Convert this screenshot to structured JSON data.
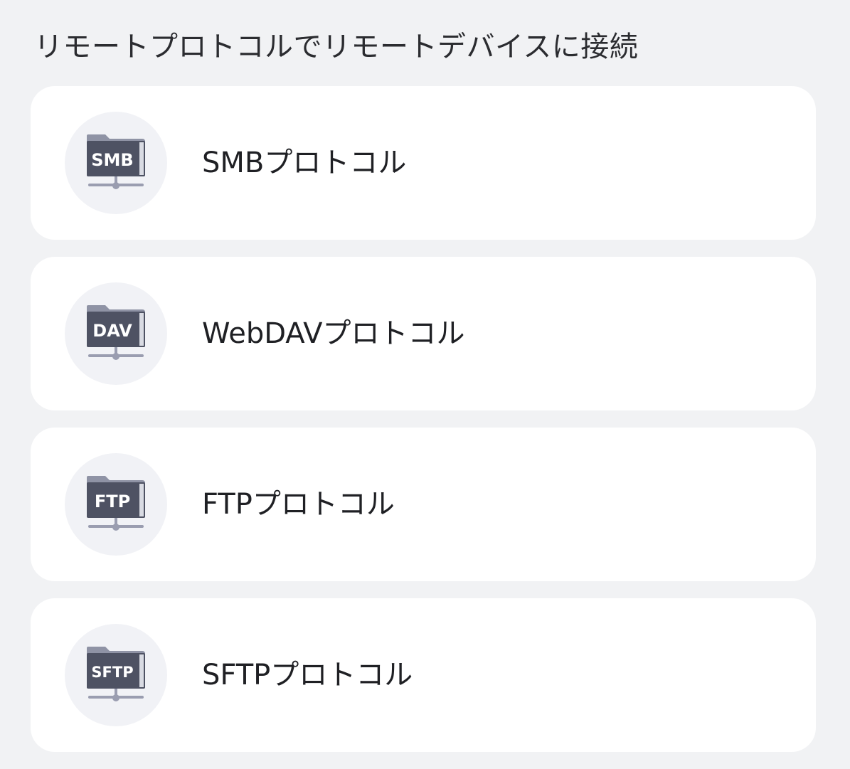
{
  "section": {
    "title": "リモートプロトコルでリモートデバイスに接続"
  },
  "protocols": [
    {
      "icon": "smb-network-folder-icon",
      "badge": "SMB",
      "label": "SMBプロトコル"
    },
    {
      "icon": "dav-network-folder-icon",
      "badge": "DAV",
      "label": "WebDAVプロトコル"
    },
    {
      "icon": "ftp-network-folder-icon",
      "badge": "FTP",
      "label": "FTPプロトコル"
    },
    {
      "icon": "sftp-network-folder-icon",
      "badge": "SFTP",
      "label": "SFTPプロトコル"
    }
  ],
  "colors": {
    "background": "#f1f2f4",
    "card": "#ffffff",
    "icon_circle": "#f1f2f6",
    "folder_dark": "#4e5263",
    "folder_light": "#d9dbe3",
    "connector": "#9a9db0"
  }
}
